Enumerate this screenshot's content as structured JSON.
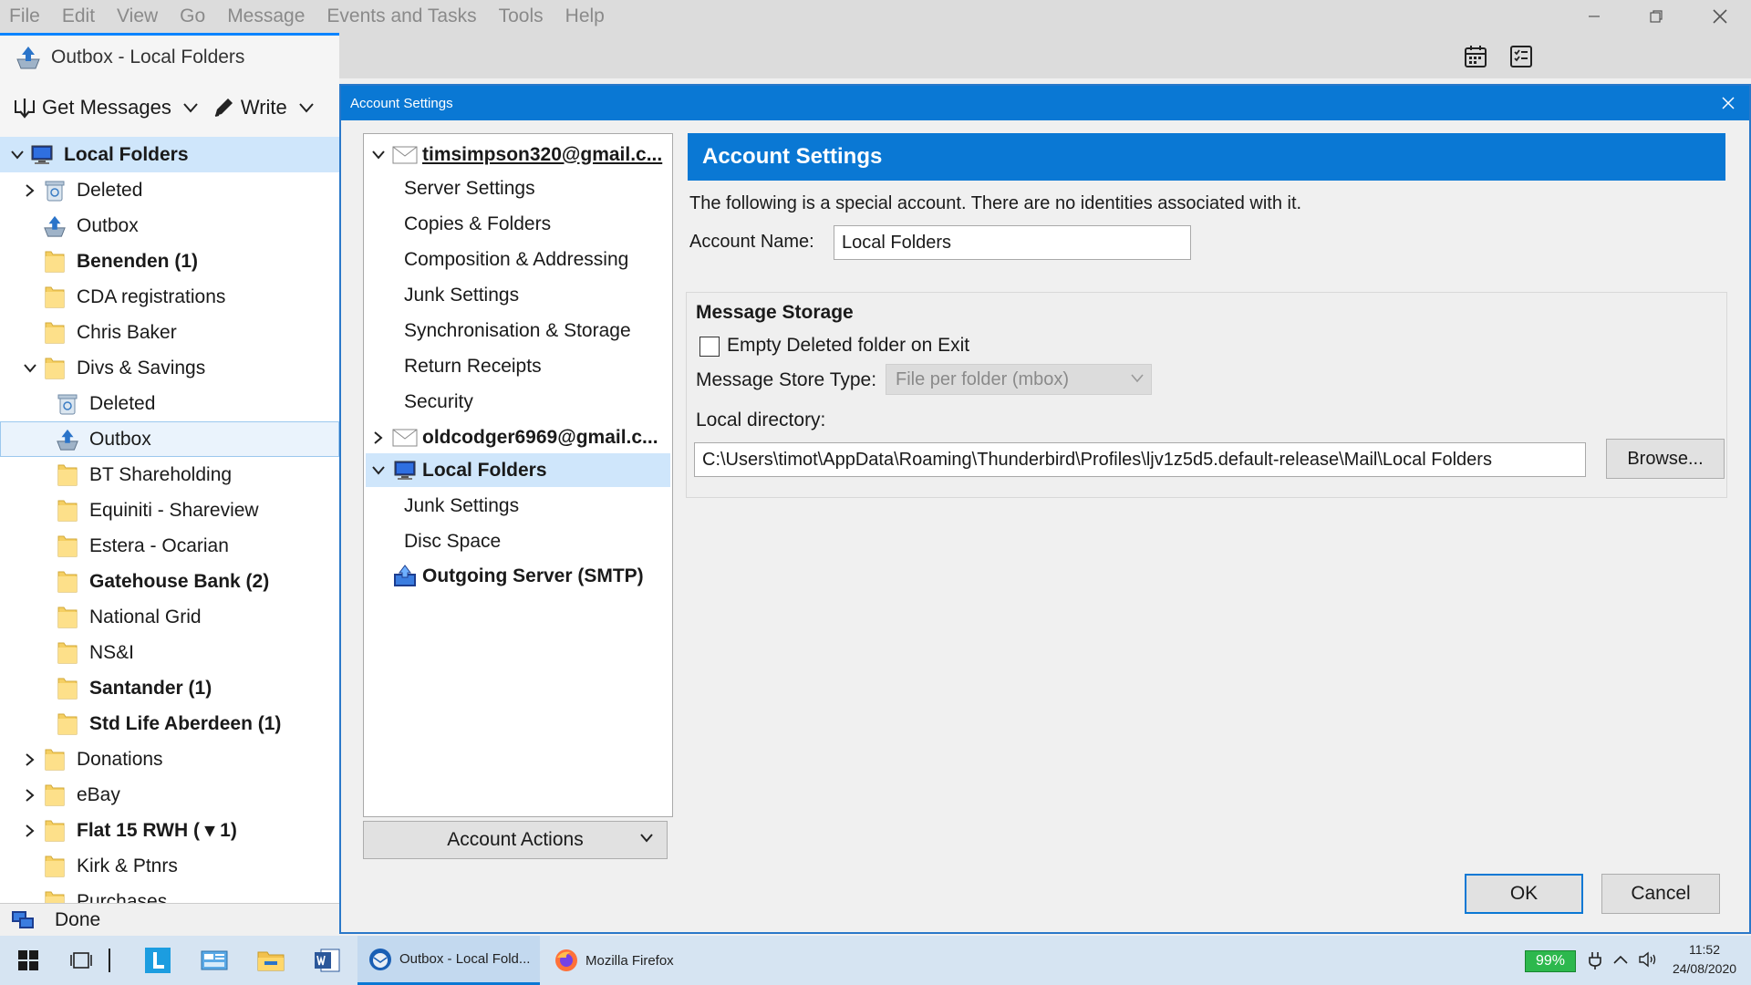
{
  "menubar": {
    "items": [
      "File",
      "Edit",
      "View",
      "Go",
      "Message",
      "Events and Tasks",
      "Tools",
      "Help"
    ]
  },
  "tab": {
    "title": "Outbox - Local Folders"
  },
  "toolbar": {
    "get_messages": "Get Messages",
    "write": "Write"
  },
  "folders": [
    {
      "name": "Local Folders",
      "bold": true,
      "icon": "computer-icon"
    },
    {
      "name": "Deleted",
      "icon": "trash-icon"
    },
    {
      "name": "Outbox",
      "icon": "outbox-icon"
    },
    {
      "name": "Benenden (1)",
      "bold": true,
      "icon": "folder-icon"
    },
    {
      "name": "CDA registrations",
      "icon": "folder-icon"
    },
    {
      "name": "Chris Baker",
      "icon": "folder-icon"
    },
    {
      "name": "Divs & Savings",
      "icon": "folder-icon"
    },
    {
      "name": "Deleted",
      "icon": "trash-icon"
    },
    {
      "name": "Outbox",
      "icon": "outbox-icon"
    },
    {
      "name": "BT Shareholding",
      "icon": "folder-icon"
    },
    {
      "name": "Equiniti - Shareview",
      "icon": "folder-icon"
    },
    {
      "name": "Estera - Ocarian",
      "icon": "folder-icon"
    },
    {
      "name": "Gatehouse Bank (2)",
      "bold": true,
      "icon": "folder-icon"
    },
    {
      "name": "National Grid",
      "icon": "folder-icon"
    },
    {
      "name": "NS&I",
      "icon": "folder-icon"
    },
    {
      "name": "Santander (1)",
      "bold": true,
      "icon": "folder-icon"
    },
    {
      "name": "Std Life Aberdeen (1)",
      "bold": true,
      "icon": "folder-icon"
    },
    {
      "name": "Donations",
      "icon": "folder-icon"
    },
    {
      "name": "eBay",
      "icon": "folder-icon"
    },
    {
      "name": "Flat 15 RWH ( ▾ 1)",
      "bold": true,
      "icon": "folder-icon"
    },
    {
      "name": "Kirk & Ptnrs",
      "icon": "folder-icon"
    },
    {
      "name": "Purchases",
      "icon": "folder-icon"
    }
  ],
  "status": {
    "text": "Done"
  },
  "dialog": {
    "title": "Account Settings",
    "tree": [
      {
        "name": "timsimpson320@gmail.c...",
        "bold": true
      },
      {
        "name": "Server Settings"
      },
      {
        "name": "Copies & Folders"
      },
      {
        "name": "Composition & Addressing"
      },
      {
        "name": "Junk Settings"
      },
      {
        "name": "Synchronisation & Storage"
      },
      {
        "name": "Return Receipts"
      },
      {
        "name": "Security"
      },
      {
        "name": "oldcodger6969@gmail.c...",
        "bold": true
      },
      {
        "name": "Local Folders",
        "bold": true
      },
      {
        "name": "Junk Settings"
      },
      {
        "name": "Disc Space"
      },
      {
        "name": "Outgoing Server (SMTP)",
        "bold": true
      }
    ],
    "account_actions": "Account Actions",
    "panel_title": "Account Settings",
    "intro": "The following is a special account. There are no identities associated with it.",
    "account_name_label": "Account Name:",
    "account_name_value": "Local Folders",
    "message_storage": {
      "heading": "Message Storage",
      "empty_deleted_label": "Empty Deleted folder on Exit",
      "empty_deleted_checked": false,
      "store_type_label": "Message Store Type:",
      "store_type_value": "File per folder (mbox)",
      "local_dir_label": "Local directory:",
      "local_dir_value": "C:\\Users\\timot\\AppData\\Roaming\\Thunderbird\\Profiles\\ljv1z5d5.default-release\\Mail\\Local Folders",
      "browse": "Browse..."
    },
    "ok": "OK",
    "cancel": "Cancel"
  },
  "taskbar": {
    "apps": [
      "Outbox - Local Fold...",
      "Mozilla Firefox"
    ],
    "battery": "99%",
    "time": "11:52",
    "date": "24/08/2020"
  },
  "colors": {
    "accent": "#0a78d4",
    "selection": "#cfe6fb",
    "battery": "#2db84d"
  }
}
